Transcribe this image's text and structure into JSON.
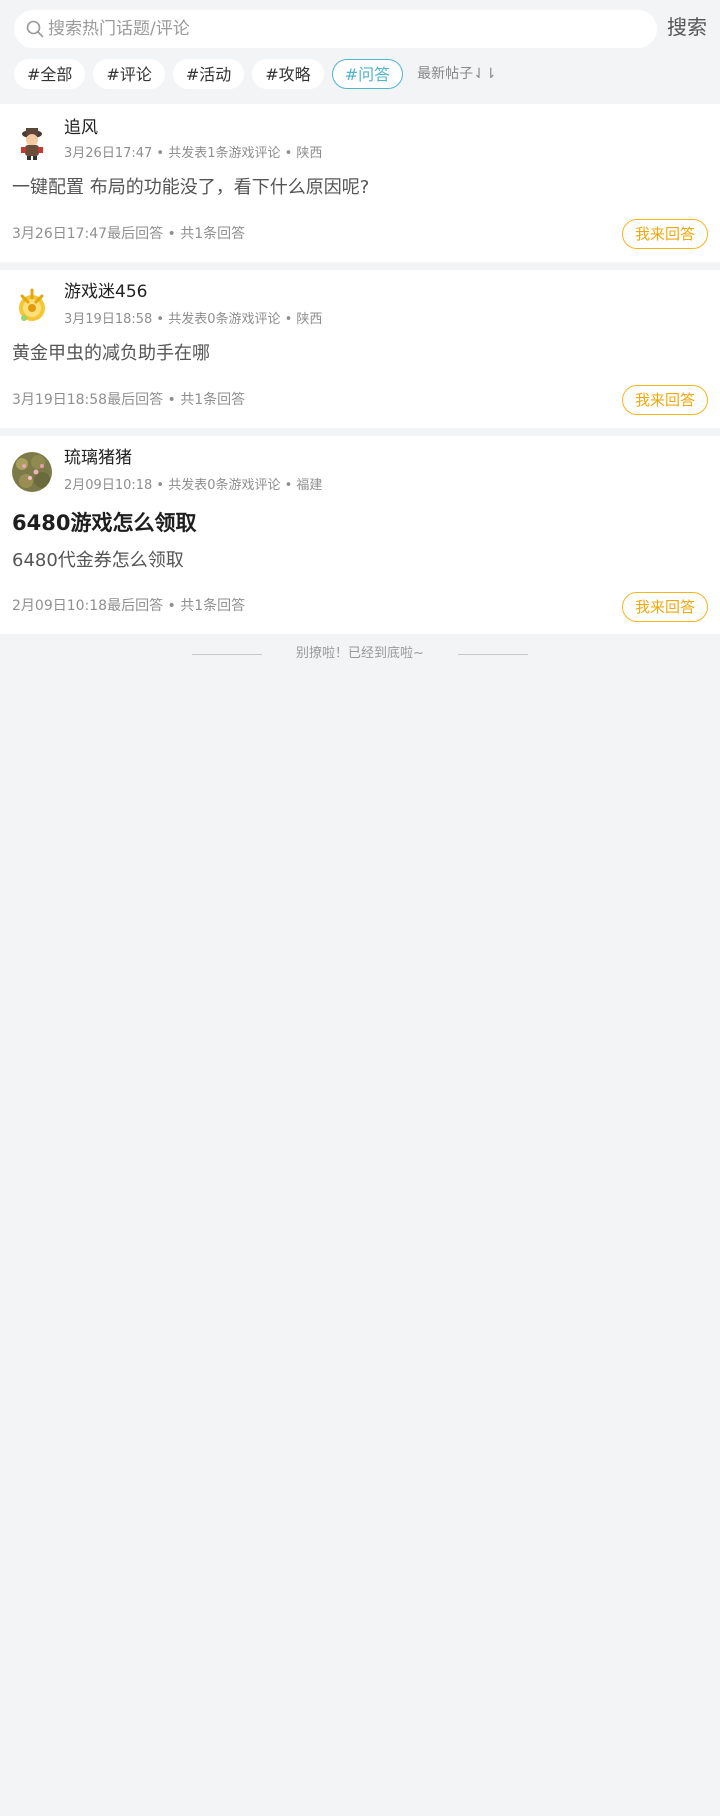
{
  "search": {
    "placeholder": "搜索热门话题/评论",
    "button_label": "搜索"
  },
  "tags": [
    {
      "label": "#全部",
      "active": false
    },
    {
      "label": "#评论",
      "active": false
    },
    {
      "label": "#活动",
      "active": false
    },
    {
      "label": "#攻略",
      "active": false
    },
    {
      "label": "#问答",
      "active": true
    }
  ],
  "sort_label": "最新帖子⇃⇂",
  "posts": [
    {
      "username": "追风",
      "meta": "3月26日17:47 • 共发表1条游戏评论 • 陕西",
      "title": "",
      "content": "一键配置 布局的功能没了，看下什么原因呢?",
      "footer": "3月26日17:47最后回答 • 共1条回答",
      "answer_label": "我来回答",
      "avatar_icon": "character-avatar-icon"
    },
    {
      "username": "游戏迷456",
      "meta": "3月19日18:58 • 共发表0条游戏评论 • 陕西",
      "title": "",
      "content": "黄金甲虫的减负助手在哪",
      "footer": "3月19日18:58最后回答 • 共1条回答",
      "answer_label": "我来回答",
      "avatar_icon": "gold-emblem-avatar-icon"
    },
    {
      "username": "琉璃猪猪",
      "meta": "2月09日10:18 • 共发表0条游戏评论 • 福建",
      "title": "6480游戏怎么领取",
      "content": "6480代金券怎么领取",
      "footer": "2月09日10:18最后回答 • 共1条回答",
      "answer_label": "我来回答",
      "avatar_icon": "flowers-avatar-icon"
    }
  ],
  "end_text": "别撩啦！已经到底啦~",
  "colors": {
    "background": "#f3f4f6",
    "active_tag": "#4fb4cd",
    "answer_button": "#f5b51d"
  }
}
